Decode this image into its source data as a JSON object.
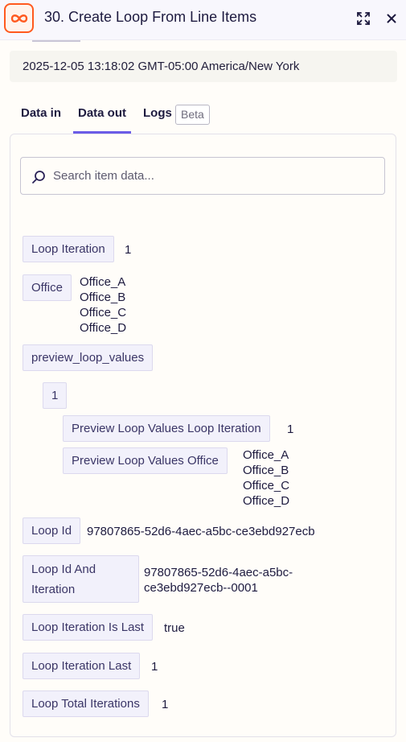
{
  "header": {
    "step_title": "30. Create Loop From Line Items",
    "app_icon": "loop-icon",
    "accent_color": "#ff5a1f"
  },
  "timestamp": "2025-12-05 13:18:02 GMT-05:00 America/New York",
  "tabs": {
    "data_in": "Data in",
    "data_out": "Data out",
    "logs": "Logs",
    "beta": "Beta",
    "active_color": "#6b5ce7"
  },
  "search": {
    "placeholder": "Search item data..."
  },
  "items": {
    "loop_iteration": {
      "key": "Loop Iteration",
      "value": "1"
    },
    "office": {
      "key": "Office",
      "values": [
        "Office_A",
        "Office_B",
        "Office_C",
        "Office_D"
      ]
    },
    "preview_loop_values": {
      "key": "preview_loop_values",
      "index_key": "1",
      "loop_iteration": {
        "key": "Preview Loop Values Loop Iteration",
        "value": "1"
      },
      "office": {
        "key": "Preview Loop Values Office",
        "values": [
          "Office_A",
          "Office_B",
          "Office_C",
          "Office_D"
        ]
      }
    },
    "loop_id": {
      "key": "Loop Id",
      "value": "97807865-52d6-4aec-a5bc-ce3ebd927ecb"
    },
    "loop_id_and_iteration": {
      "key_line1": "Loop Id And",
      "key_line2": "Iteration",
      "value_line1": "97807865-52d6-4aec-a5bc-",
      "value_line2": "ce3ebd927ecb--0001"
    },
    "loop_iteration_is_last": {
      "key": "Loop Iteration Is Last",
      "value": "true"
    },
    "loop_iteration_last": {
      "key": "Loop Iteration Last",
      "value": "1"
    },
    "loop_total_iterations": {
      "key": "Loop Total Iterations",
      "value": "1"
    }
  }
}
